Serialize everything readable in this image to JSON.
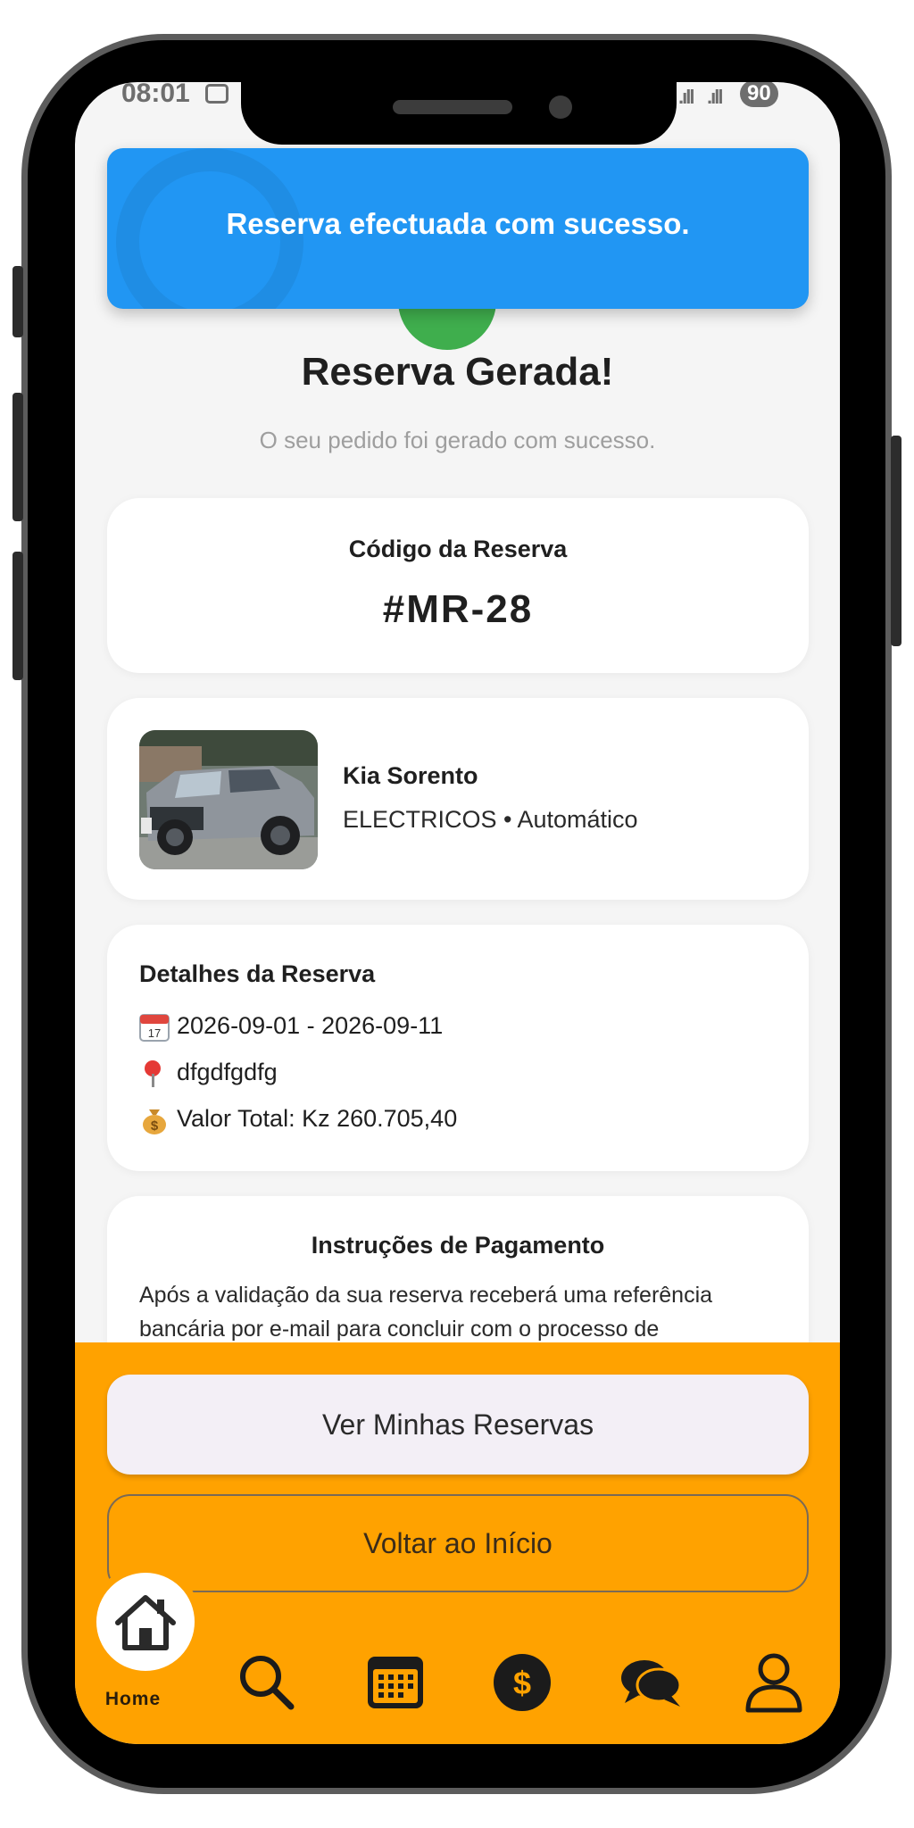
{
  "status_bar": {
    "time": "08:01",
    "signal_1": ".ıll",
    "signal_2": ".ıll",
    "battery": "90"
  },
  "toast": {
    "message": "Reserva efectuada com sucesso."
  },
  "header": {
    "title": "Reserva Gerada!",
    "subtitle": "O seu pedido foi gerado com sucesso."
  },
  "reservation_code": {
    "label": "Código da Reserva",
    "value": "#MR-28"
  },
  "vehicle": {
    "name": "Kia Sorento",
    "meta": "ELECTRICOS • Automático"
  },
  "details": {
    "title": "Detalhes da Reserva",
    "dates": "2026-09-01 - 2026-09-11",
    "location": "dfgdfgdfg",
    "total": "Valor Total: Kz  260.705,40",
    "calendar_icon_day": "17"
  },
  "payment_instructions": {
    "title": "Instruções de Pagamento",
    "text": "Após a validação da sua reserva receberá uma referência bancária por e-mail para concluir com o processo de"
  },
  "actions": {
    "primary_label": "Ver Minhas Reservas",
    "secondary_label": "Voltar ao Início"
  },
  "tabbar": {
    "home_label": "Home",
    "icons": [
      "home-icon",
      "search-icon",
      "calendar-icon",
      "dollar-icon",
      "chat-icon",
      "user-icon"
    ],
    "dollar_glyph": "$"
  },
  "colors": {
    "accent": "#ffa200",
    "toast": "#2196f3",
    "success": "#3fae4d"
  }
}
